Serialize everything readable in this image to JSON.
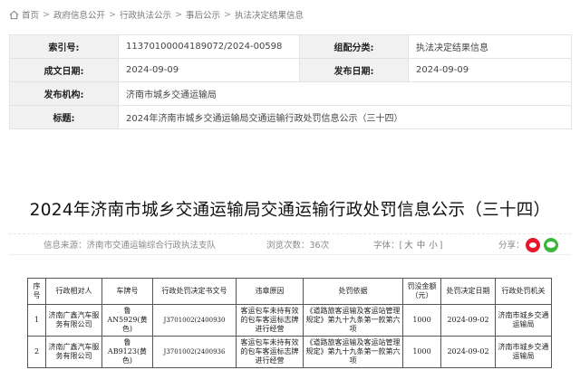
{
  "breadcrumb": [
    "首页",
    "政府信息公开",
    "行政执法公示",
    "事后公示",
    "执法决定结果信息"
  ],
  "meta": {
    "index_label": "索引号:",
    "index_value": "11370100004189072/2024-00598",
    "category_label": "组配分类:",
    "category_value": "执法决定结果信息",
    "date_label": "成文日期:",
    "date_value": "2024-09-09",
    "pubdate_label": "发布日期:",
    "pubdate_value": "2024-09-09",
    "org_label": "发布机构:",
    "org_value": "济南市城乡交通运输局",
    "title_label": "标题:",
    "title_value": "2024年济南市城乡交通运输局交通运输行政处罚信息公示（三十四）"
  },
  "article_title": "2024年济南市城乡交通运输局交通运输行政处罚信息公示（三十四）",
  "info": {
    "source": "信息来源：济南市交通运输综合行政执法支队",
    "views": "浏览次数：36次",
    "font_label": "字体：[",
    "font_large": "大",
    "font_medium": "中",
    "font_small": "小",
    "font_end": "]",
    "share_label": "分享："
  },
  "table": {
    "headers": [
      "序号",
      "行政相对人",
      "车牌号",
      "行政处罚决定书文号",
      "违章原因",
      "处罚依据",
      "罚没金额（元）",
      "处罚决定日期",
      "行政处罚机关"
    ],
    "rows": [
      [
        "1",
        "济南广鑫汽车服务有限公司",
        "鲁AN5929(黄色)",
        "J3701002(2400930",
        "客运包车未持有效的包车客运标志牌进行经营",
        "《道路旅客运输及客运站管理规定》第九十九条第一款第六项",
        "1000",
        "2024-09-02",
        "济南市城乡交通运输局"
      ],
      [
        "2",
        "济南广鑫汽车服务有限公司",
        "鲁AB9123(黄色)",
        "J3701002(2400936",
        "客运包车未持有效的包车客运标志牌进行经营",
        "《道路旅客运输及客运站管理规定》第九十九条第一款第六项",
        "1000",
        "2024-09-02",
        "济南市城乡交通运输局"
      ]
    ]
  }
}
